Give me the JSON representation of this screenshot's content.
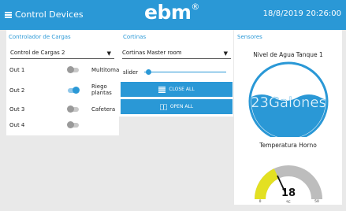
{
  "header": {
    "menu_label": "Control Devices",
    "logo_text": "ebm",
    "logo_mark": "®",
    "datetime": "18/8/2019 20:26:00",
    "background": "#2a98d6"
  },
  "cargas": {
    "title": "Controlador de Cargas",
    "selected": "Control de Cargas 2",
    "rows": [
      {
        "label": "Out 1",
        "state": "off",
        "desc": "Multitoma"
      },
      {
        "label": "Out 2",
        "state": "on",
        "desc": "Riego plantas"
      },
      {
        "label": "Out 3",
        "state": "off",
        "desc": "Cafetera"
      },
      {
        "label": "Out 4",
        "state": "off",
        "desc": ""
      }
    ]
  },
  "cortinas": {
    "title": "Cortinas",
    "selected": "Cortinas Master room",
    "slider_label": "slider",
    "slider_value": 0.03,
    "close_all": "CLOSE ALL",
    "open_all": "OPEN ALL"
  },
  "sensores": {
    "title": "Sensores",
    "tank": {
      "title": "Nivel de Agua Tanque 1",
      "value_text": "23Galones",
      "fill_fraction": 0.5,
      "color": "#2a98d6"
    },
    "gauge": {
      "title": "Temperatura Horno",
      "value": 18,
      "min": 0,
      "max": 50,
      "min_label": "0",
      "max_label": "50",
      "unit": "ºC",
      "fill_color": "#e3e022",
      "track_color": "#bdbdbd"
    }
  },
  "icons": {
    "menu": "menu-icon",
    "close_all": "close-icon",
    "open_all": "open-icon"
  }
}
